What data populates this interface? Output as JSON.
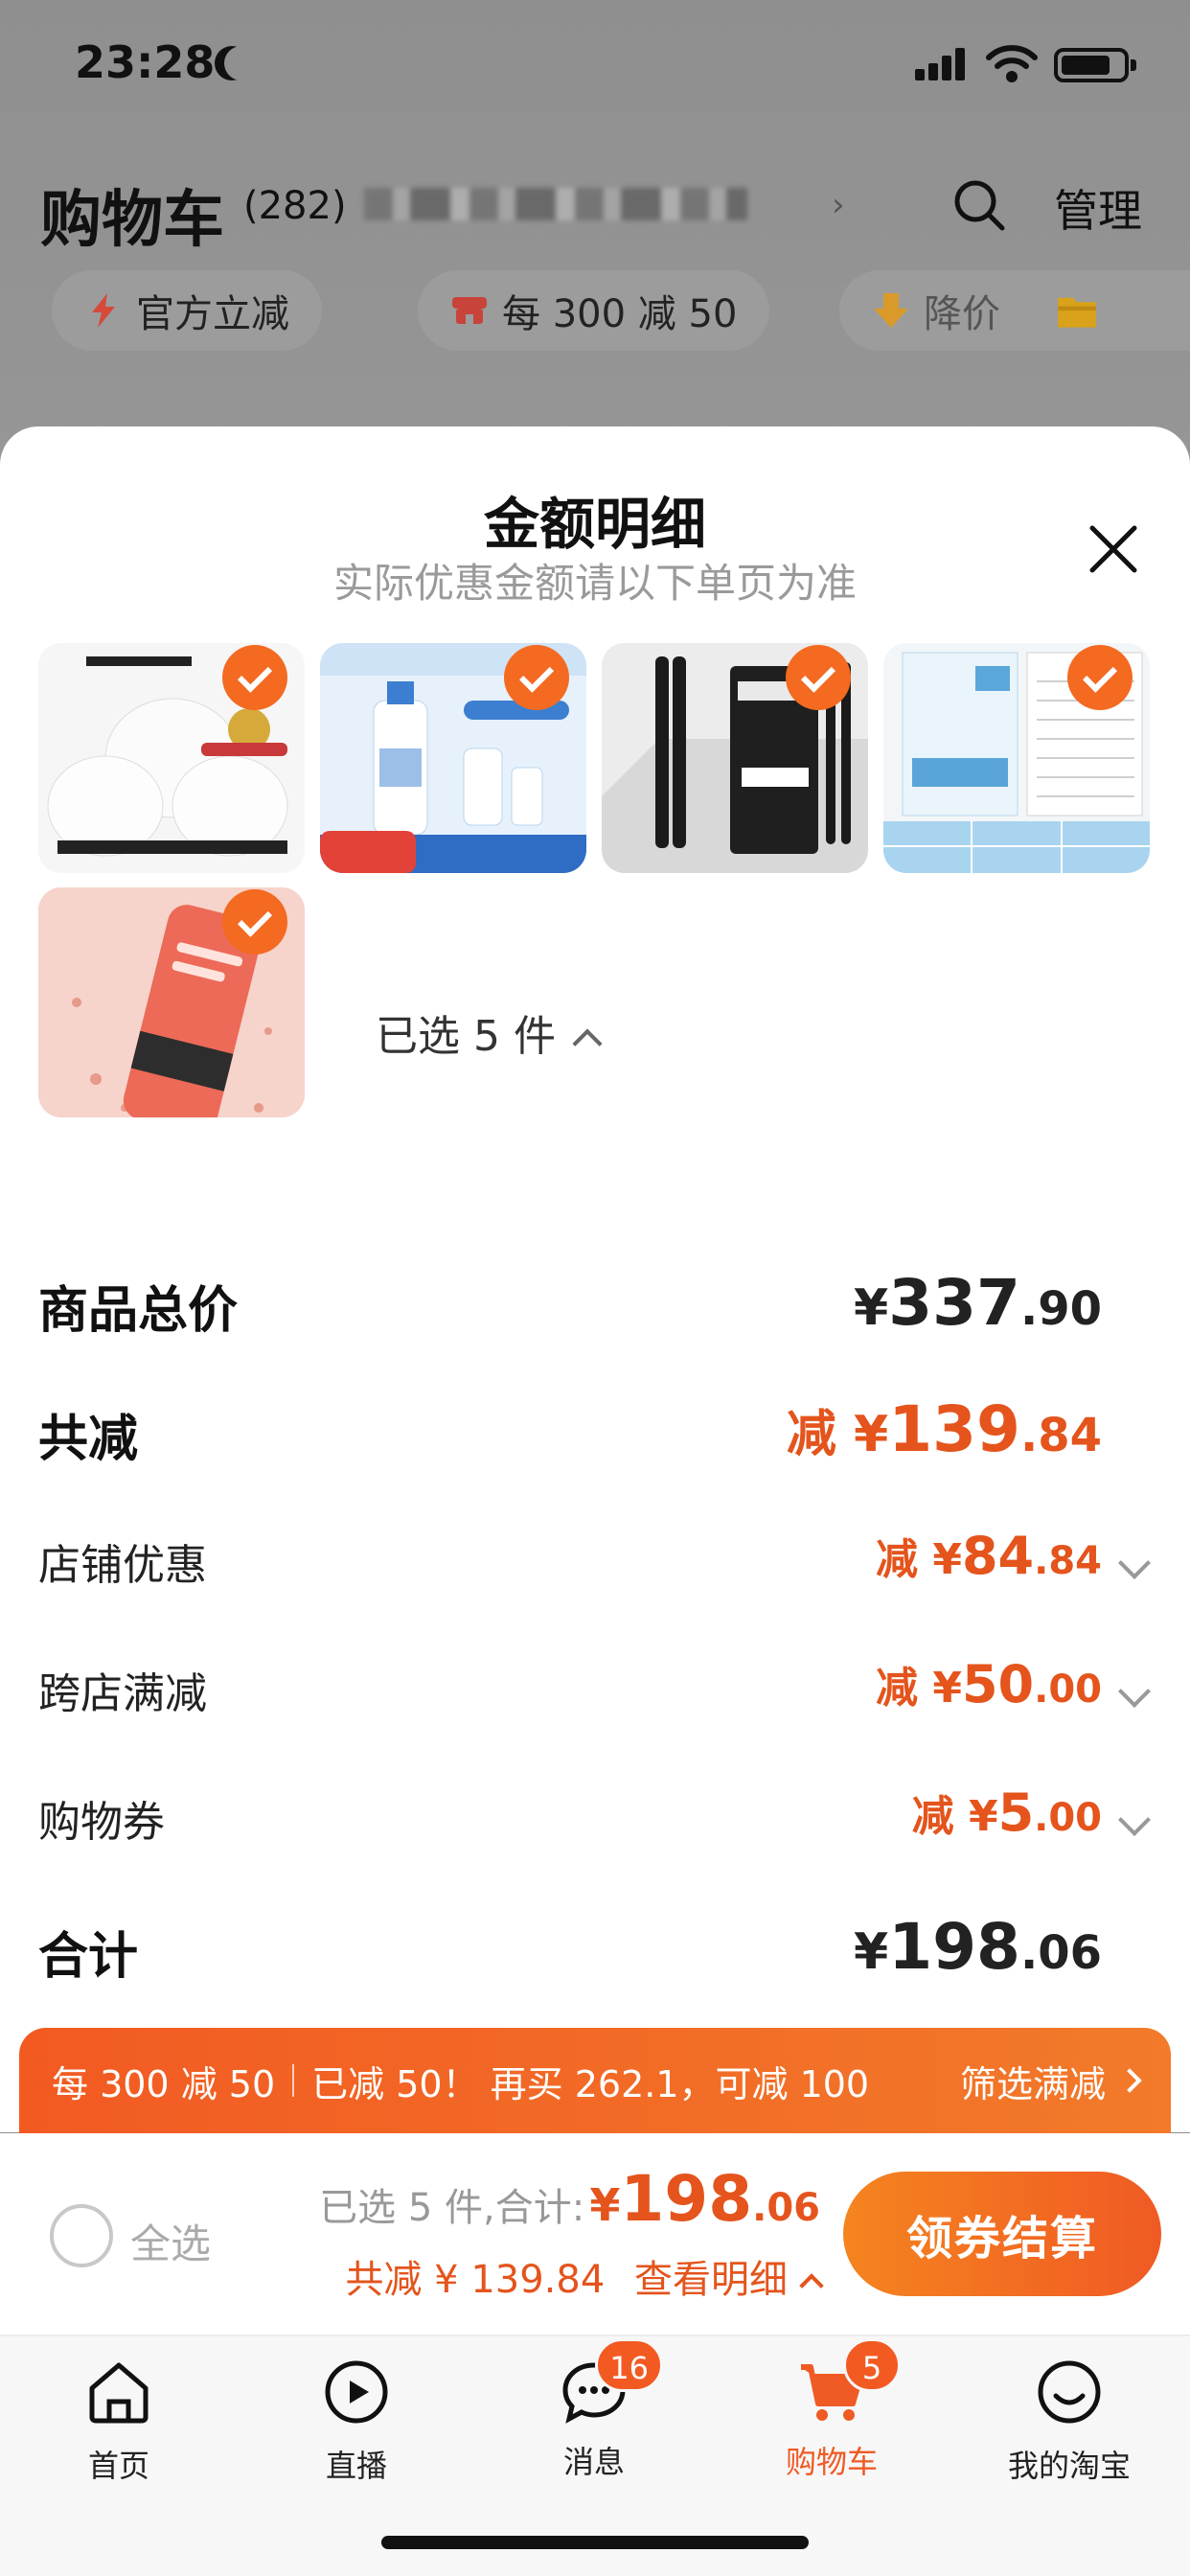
{
  "status_bar": {
    "time": "23:28"
  },
  "header": {
    "title": "购物车",
    "count": "(282)",
    "manage_label": "管理"
  },
  "filter_chips": [
    {
      "label": "官方立减"
    },
    {
      "label": "每 300 减 50"
    },
    {
      "label": "降价"
    }
  ],
  "sheet": {
    "title": "金额明细",
    "subtitle": "实际优惠金额请以下单页为准",
    "selected_label": "已选 5 件"
  },
  "summary": {
    "goods_total": {
      "label": "商品总价",
      "symbol": "¥",
      "int": "337",
      "frac": ".90"
    },
    "total_discount": {
      "label": "共减",
      "prefix": "减 ",
      "symbol": "¥",
      "int": "139",
      "frac": ".84"
    },
    "shop_discount": {
      "label": "店铺优惠",
      "prefix": "减 ",
      "symbol": "¥",
      "int": "84",
      "frac": ".84"
    },
    "cross_shop": {
      "label": "跨店满减",
      "prefix": "减 ",
      "symbol": "¥",
      "int": "50",
      "frac": ".00"
    },
    "coupon": {
      "label": "购物券",
      "prefix": "减 ",
      "symbol": "¥",
      "int": "5",
      "frac": ".00"
    },
    "total": {
      "label": "合计",
      "symbol": "¥",
      "int": "198",
      "frac": ".06"
    }
  },
  "promo": {
    "rule": "每 300 减 50",
    "status": "已减 50！ 再买 262.1，可减 100",
    "action": "筛选满减"
  },
  "checkout": {
    "select_all": "全选",
    "selected_prefix": "已选 5 件,合计:",
    "symbol": "¥",
    "total_int": "198",
    "total_frac": ".06",
    "saved": "共减 ¥ 139.84",
    "details": "查看明细",
    "pay_button": "领券结算"
  },
  "tabbar": [
    {
      "label": "首页",
      "icon": "home-icon"
    },
    {
      "label": "直播",
      "icon": "live-icon"
    },
    {
      "label": "消息",
      "icon": "message-icon",
      "badge": "16"
    },
    {
      "label": "购物车",
      "icon": "cart-icon",
      "badge": "5",
      "active": true
    },
    {
      "label": "我的淘宝",
      "icon": "profile-icon"
    }
  ],
  "colors": {
    "accent": "#F25A22",
    "price": "#E4541C"
  }
}
